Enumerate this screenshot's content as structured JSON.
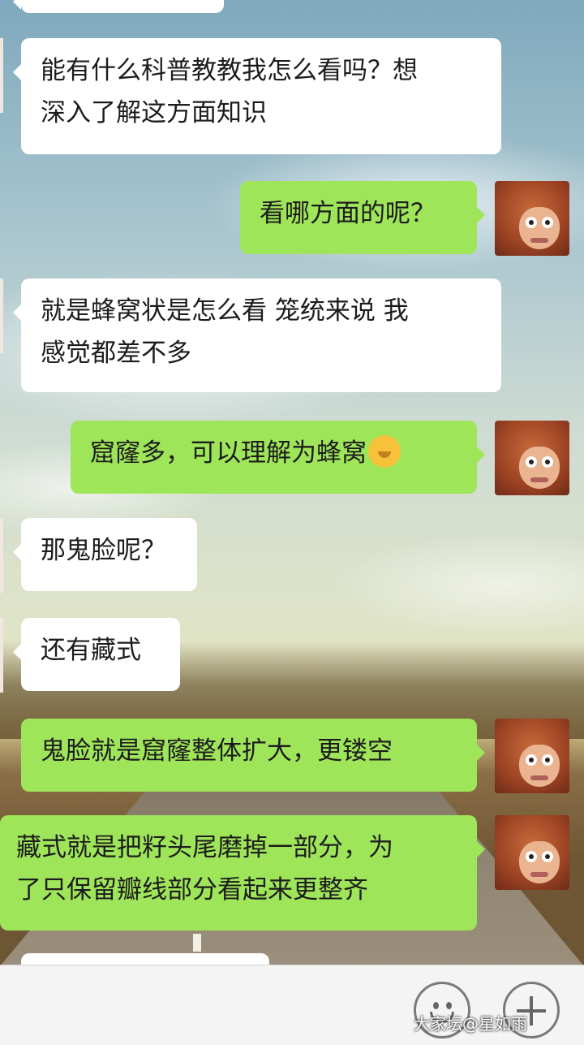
{
  "messages": [
    {
      "dir": "in",
      "text_lines": [
        "能有什么科普教教我怎么看吗？想",
        "深入了解这方面知识"
      ]
    },
    {
      "dir": "out",
      "text_lines": [
        "看哪方面的呢？"
      ]
    },
    {
      "dir": "in",
      "text_lines": [
        "就是蜂窝状是怎么看 笼统来说 我",
        "感觉都差不多"
      ]
    },
    {
      "dir": "out",
      "text_lines": [
        "窟窿多，可以理解为蜂窝"
      ],
      "emoji": "thinking-face"
    },
    {
      "dir": "in",
      "text_lines": [
        "那鬼脸呢？"
      ]
    },
    {
      "dir": "in",
      "text_lines": [
        "还有藏式"
      ]
    },
    {
      "dir": "out",
      "text_lines": [
        "鬼脸就是窟窿整体扩大，更镂空"
      ]
    },
    {
      "dir": "out",
      "text_lines": [
        "藏式就是把籽头尾磨掉一部分，为",
        "了只保留瓣线部分看起来更整齐"
      ]
    }
  ],
  "colors": {
    "incoming_bubble": "#ffffff",
    "outgoing_bubble": "#9fe55a",
    "text": "#1c1c1c"
  },
  "icons": {
    "avatar": "monkey-king-avatar",
    "emoji_button": "smiley-icon",
    "more_button": "plus-icon"
  },
  "watermark": "大家坛@星如雨"
}
